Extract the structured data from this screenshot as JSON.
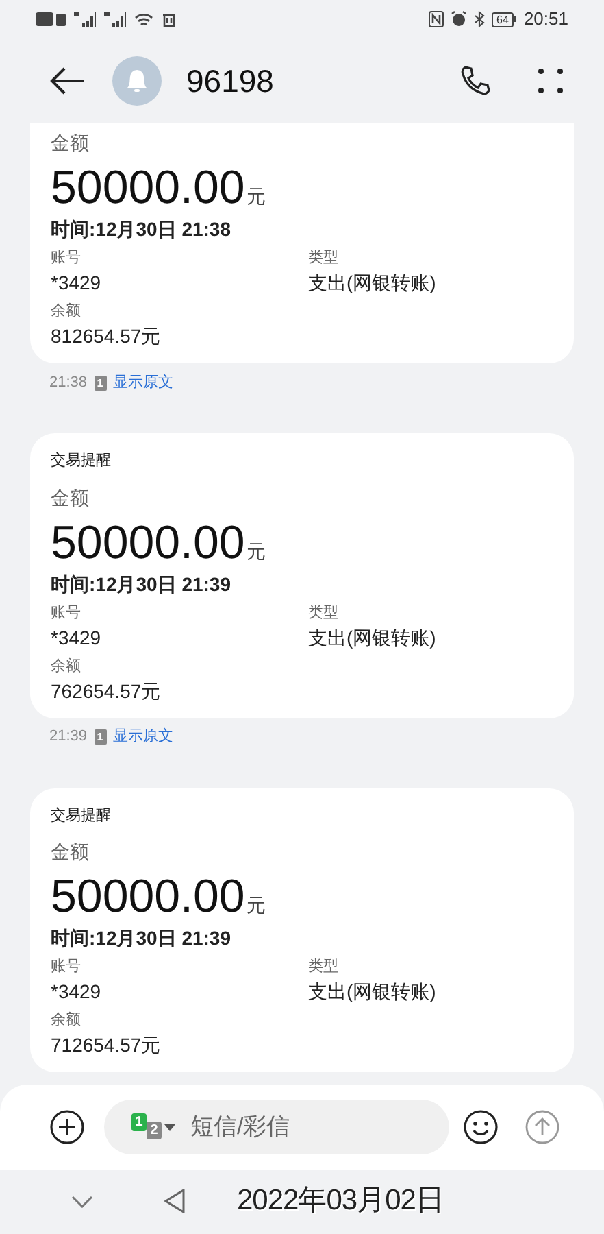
{
  "status_bar": {
    "battery": "64",
    "time": "20:51"
  },
  "header": {
    "title": "96198"
  },
  "messages": [
    {
      "amount_label": "金额",
      "amount": "50000.00",
      "unit": "元",
      "time": "时间:12月30日 21:38",
      "account_label": "账号",
      "account": "*3429",
      "type_label": "类型",
      "type": "支出(网银转账)",
      "balance_label": "余额",
      "balance": "812654.57元",
      "footer": {
        "time": "21:38",
        "sim": "1",
        "link": "显示原文"
      }
    },
    {
      "title": "交易提醒",
      "amount_label": "金额",
      "amount": "50000.00",
      "unit": "元",
      "time": "时间:12月30日 21:39",
      "account_label": "账号",
      "account": "*3429",
      "type_label": "类型",
      "type": "支出(网银转账)",
      "balance_label": "余额",
      "balance": "762654.57元",
      "footer": {
        "time": "21:39",
        "sim": "1",
        "link": "显示原文"
      }
    },
    {
      "title": "交易提醒",
      "amount_label": "金额",
      "amount": "50000.00",
      "unit": "元",
      "time": "时间:12月30日 21:39",
      "account_label": "账号",
      "account": "*3429",
      "type_label": "类型",
      "type": "支出(网银转账)",
      "balance_label": "余额",
      "balance": "712654.57元"
    }
  ],
  "composer": {
    "sim_primary": "1",
    "sim_secondary": "2",
    "placeholder": "短信/彩信"
  },
  "date_stamp": "2022年03月02日"
}
